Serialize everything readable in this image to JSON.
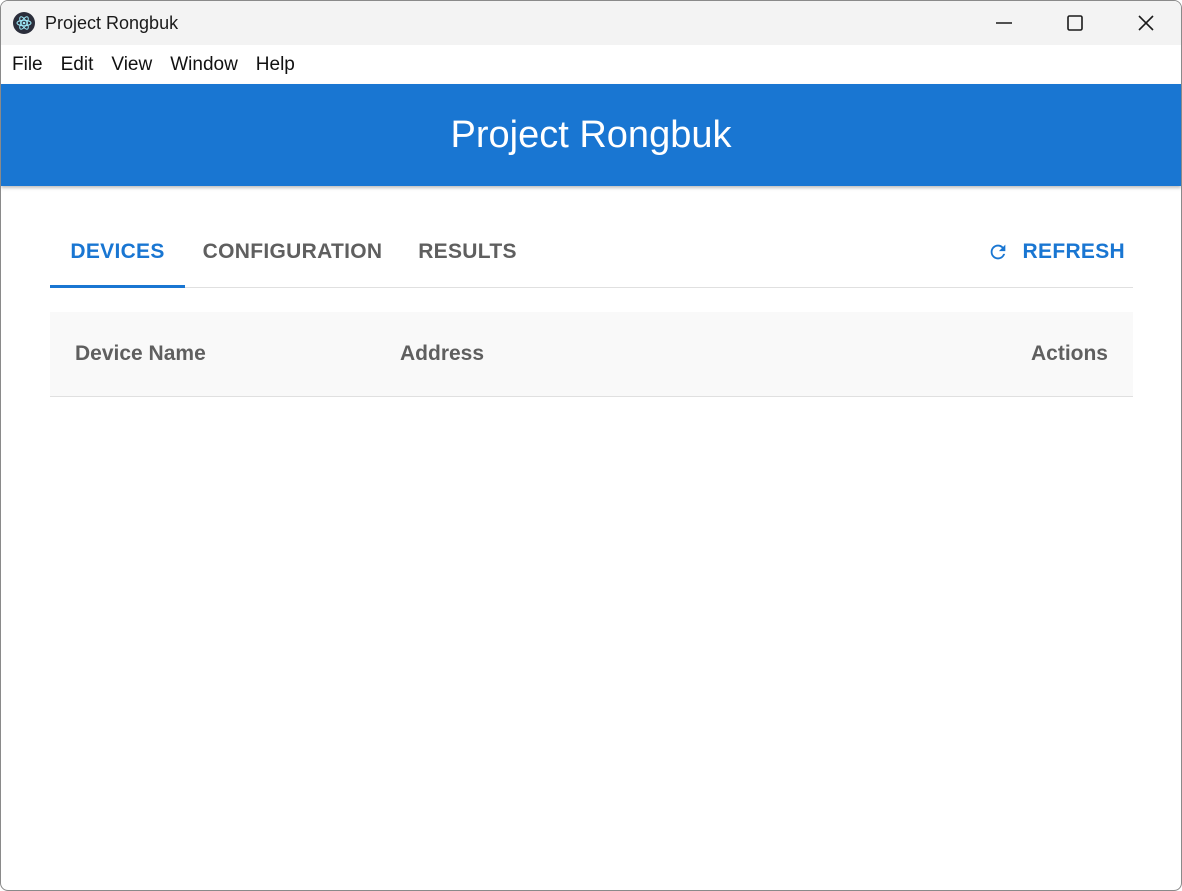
{
  "window": {
    "title": "Project Rongbuk",
    "controls": [
      "minimize-icon",
      "maximize-icon",
      "close-icon"
    ]
  },
  "menubar": {
    "items": [
      "File",
      "Edit",
      "View",
      "Window",
      "Help"
    ]
  },
  "header": {
    "title": "Project Rongbuk"
  },
  "tabs": [
    {
      "label": "DEVICES",
      "active": true
    },
    {
      "label": "CONFIGURATION",
      "active": false
    },
    {
      "label": "RESULTS",
      "active": false
    }
  ],
  "refresh": {
    "label": "REFRESH",
    "icon": "refresh-icon"
  },
  "table": {
    "columns": [
      "Device Name",
      "Address",
      "Actions"
    ],
    "rows": []
  },
  "colors": {
    "primary": "#1976d2",
    "tab_inactive": "#5f5f5f",
    "titlebar_bg": "#f3f3f3",
    "table_head_bg": "#f9f9f9"
  }
}
